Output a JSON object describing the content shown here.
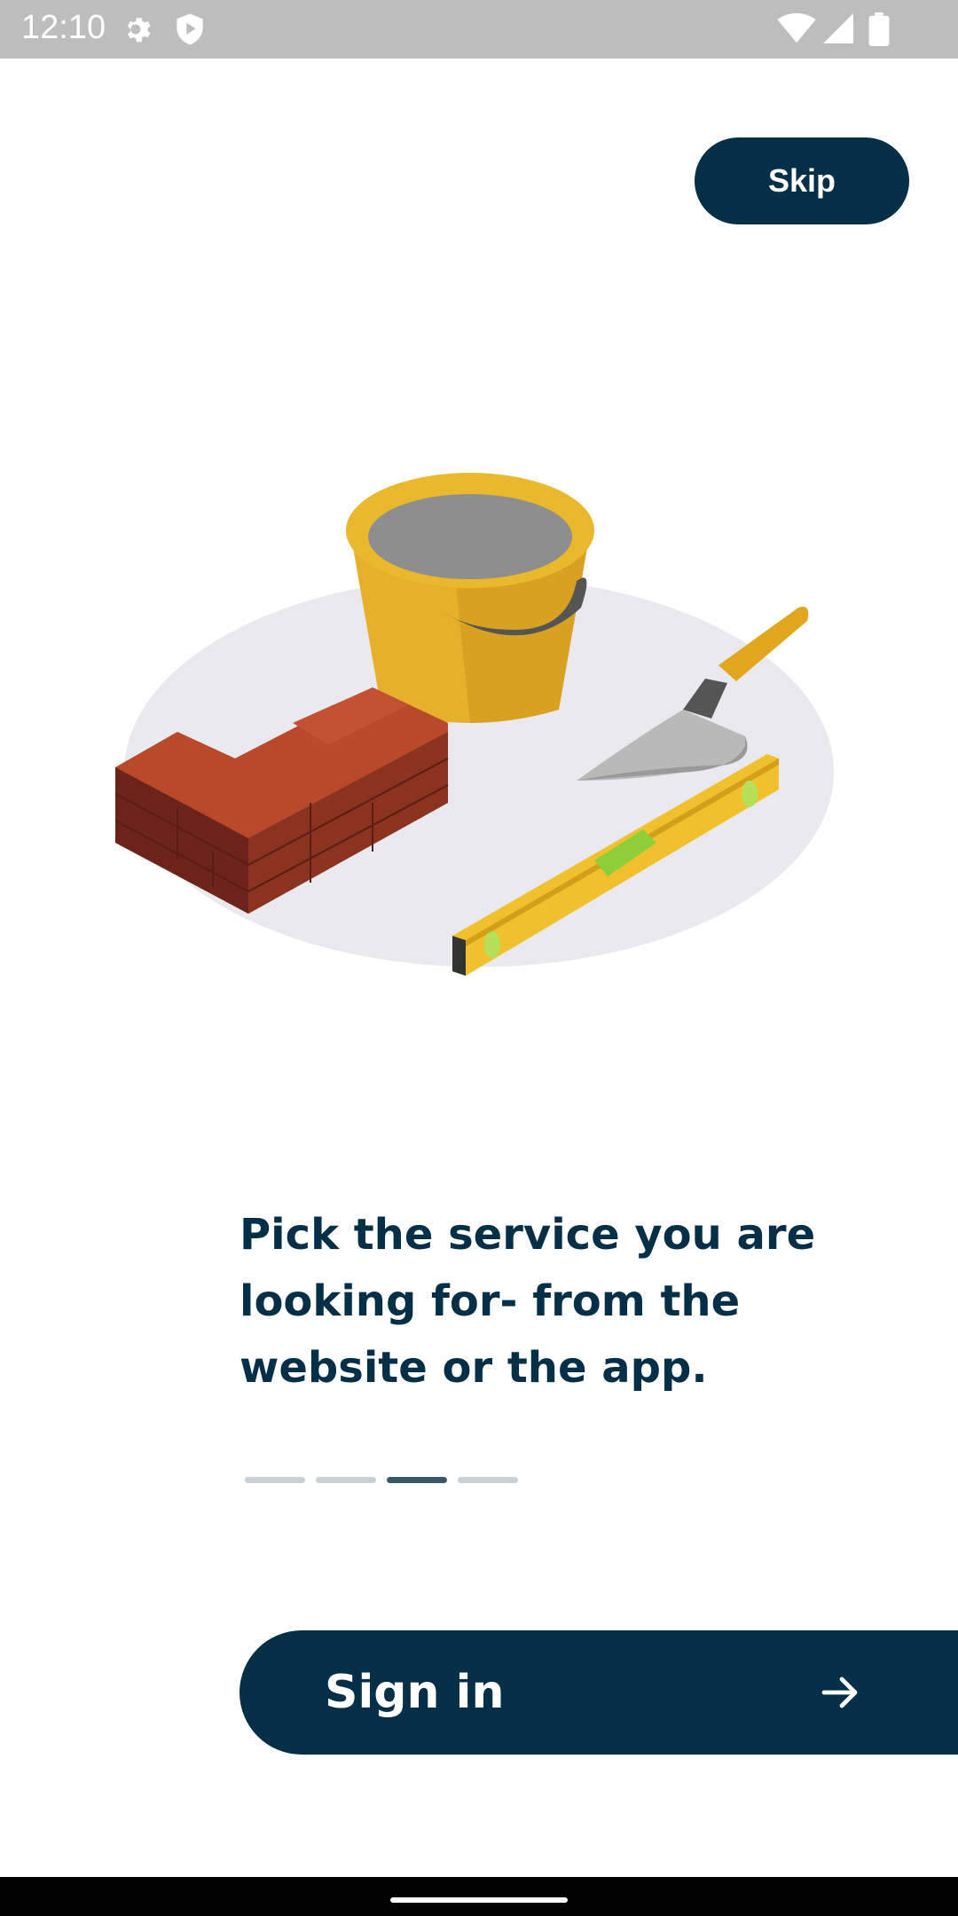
{
  "status_bar": {
    "time": "12:10",
    "icons_left": [
      "gear-icon",
      "shield-play-icon"
    ],
    "icons_right": [
      "wifi-icon",
      "signal-icon",
      "battery-icon"
    ]
  },
  "header": {
    "skip_label": "Skip"
  },
  "onboarding": {
    "illustration": "bricks-bucket-trowel-level",
    "headline": "Pick the service you are looking for- from the website or the app.",
    "page_indicator": {
      "total": 4,
      "active_index": 2
    }
  },
  "footer": {
    "signin_label": "Sign in",
    "signin_icon": "arrow-right-icon"
  },
  "colors": {
    "primary": "#052f47",
    "indicator_active": "#3a5868",
    "indicator_inactive": "#c9d1d6"
  }
}
